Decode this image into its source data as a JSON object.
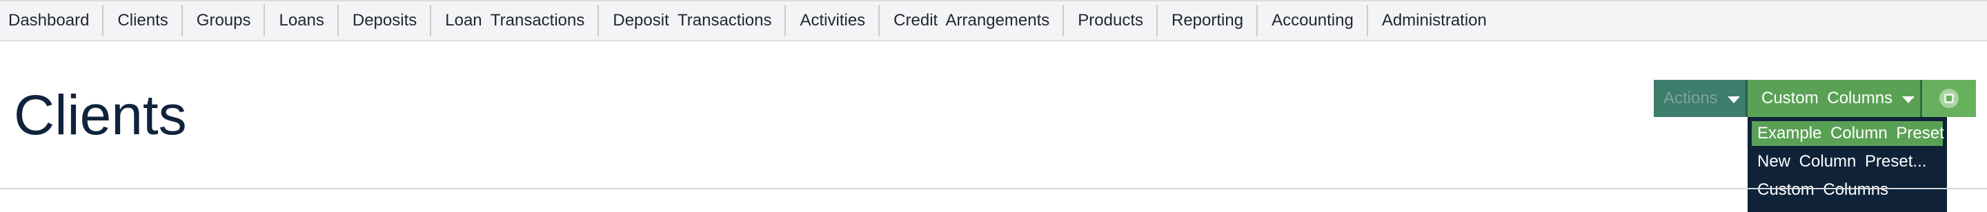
{
  "nav": {
    "items": [
      {
        "label": "Dashboard"
      },
      {
        "label": "Clients"
      },
      {
        "label": "Groups"
      },
      {
        "label": "Loans"
      },
      {
        "label": "Deposits"
      },
      {
        "label": "Loan Transactions"
      },
      {
        "label": "Deposit Transactions"
      },
      {
        "label": "Activities"
      },
      {
        "label": "Credit Arrangements"
      },
      {
        "label": "Products"
      },
      {
        "label": "Reporting"
      },
      {
        "label": "Accounting"
      },
      {
        "label": "Administration"
      }
    ]
  },
  "page": {
    "title": "Clients"
  },
  "toolbar": {
    "actions_label": "Actions",
    "custom_columns_label": "Custom Columns",
    "export_icon": "excel-export-icon"
  },
  "dropdown": {
    "items": [
      {
        "label": "Example Column Preset",
        "active": true
      },
      {
        "label": "New Column Preset...",
        "active": false
      },
      {
        "label": "Custom Columns",
        "active": false
      }
    ]
  },
  "colors": {
    "actions_bg": "#3c7d6c",
    "custom_columns_bg": "#5aa156",
    "export_bg": "#67b15e",
    "dropdown_bg": "#0f2238",
    "dropdown_active": "#5aa156",
    "title": "#10233d"
  }
}
